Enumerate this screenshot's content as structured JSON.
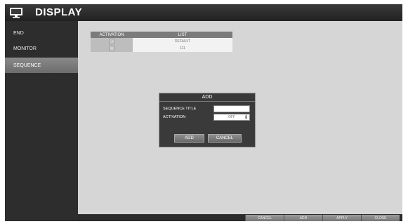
{
  "header": {
    "title": "DISPLAY",
    "icon": "monitor-icon"
  },
  "sidebar": {
    "items": [
      {
        "label": "END",
        "active": false
      },
      {
        "label": "MONITOR",
        "active": false
      },
      {
        "label": "SEQUENCE",
        "active": true
      }
    ]
  },
  "table": {
    "headers": [
      "ACTIVATION",
      "LIST"
    ],
    "rows": [
      {
        "checked": true,
        "name": "DEFAULT"
      },
      {
        "checked": false,
        "name": "111"
      }
    ]
  },
  "dialog": {
    "title": "ADD",
    "sequence_title_label": "SEQUENCE TITLE",
    "sequence_title_value": "",
    "activation_label": "ACTIVATION",
    "activation_value": "OFF",
    "add_label": "ADD",
    "cancel_label": "CANCEL"
  },
  "footer": {
    "cancel_label": "CANCEL",
    "add_label": "ADD",
    "apply_label": "APPLY",
    "close_label": "CLOSE"
  },
  "colors": {
    "accent": "#2b2b2b",
    "panel": "#d6d6d6",
    "active_item": "#7a7a7a"
  }
}
